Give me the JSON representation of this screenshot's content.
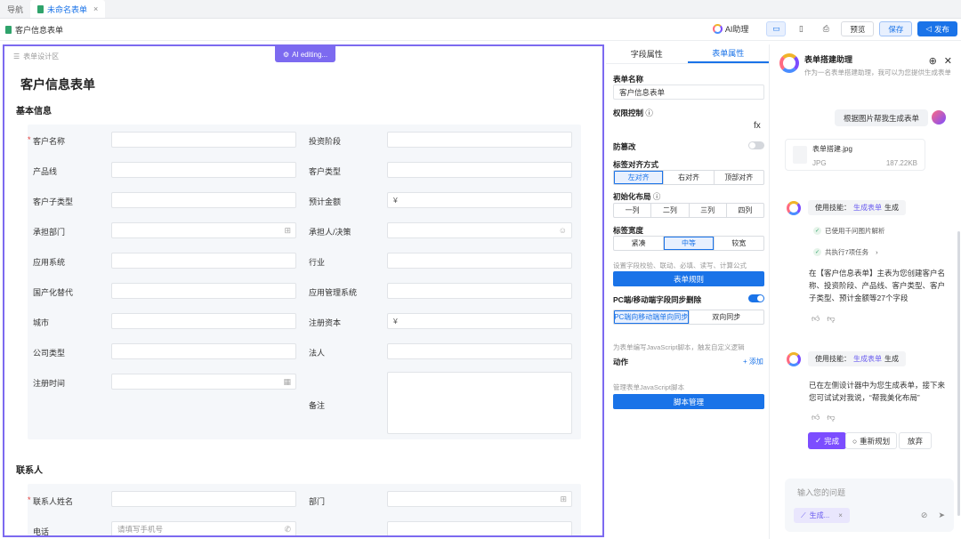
{
  "tabs": [
    {
      "label": "导航"
    },
    {
      "label": "未命名表单",
      "close": "×"
    }
  ],
  "toolbar": {
    "doc_title": "客户信息表单",
    "ai_assistant": "AI助理",
    "preview": "预览",
    "save": "保存",
    "publish": "发布"
  },
  "canvas": {
    "design_label": "表单设计区",
    "ai_editing": "AI editing...",
    "form_title": "客户信息表单",
    "section_basic": "基本信息",
    "section_contact": "联系人",
    "currency_symbol": "¥",
    "fields_basic": [
      {
        "label": "客户名称",
        "required": "*"
      },
      {
        "label": "投资阶段"
      },
      {
        "label": "产品线"
      },
      {
        "label": "客户类型"
      },
      {
        "label": "客户子类型"
      },
      {
        "label": "预计金额"
      },
      {
        "label": "承担部门"
      },
      {
        "label": "承担人/决策"
      },
      {
        "label": "应用系统"
      },
      {
        "label": "行业"
      },
      {
        "label": "国产化替代"
      },
      {
        "label": "应用管理系统"
      },
      {
        "label": "城市"
      },
      {
        "label": "注册资本"
      },
      {
        "label": "公司类型"
      },
      {
        "label": "法人"
      },
      {
        "label": "注册时间"
      },
      {
        "label": "备注"
      }
    ],
    "fields_contact": [
      {
        "label": "联系人姓名",
        "required": "*"
      },
      {
        "label": "部门"
      },
      {
        "label": "电话",
        "placeholder": "请填写手机号"
      }
    ]
  },
  "props": {
    "tab_field": "字段属性",
    "tab_form": "表单属性",
    "form_name_label": "表单名称",
    "form_name_value": "客户信息表单",
    "permission_label": "权限控制",
    "fx": "fx",
    "tamper_label": "防篡改",
    "label_align_label": "标签对齐方式",
    "label_align_opts": [
      "左对齐",
      "右对齐",
      "顶部对齐"
    ],
    "init_layout_label": "初始化布局",
    "init_layout_opts": [
      "一列",
      "二列",
      "三列",
      "四列"
    ],
    "label_width_label": "标签宽度",
    "label_width_opts": [
      "紧凑",
      "中等",
      "较宽"
    ],
    "rules_hint": "设置字段校验、联动、必填、读写、计算公式",
    "rules_btn": "表单规则",
    "sync_label": "PC端/移动端字段同步删除",
    "sync_opts": [
      "PC端向移动端单向同步",
      "双向同步"
    ],
    "js_hint": "为表单编写JavaScript脚本，触发自定义逻辑",
    "action_label": "动作",
    "add_label": "+ 添加",
    "js_manage_hint": "管理表单JavaScript脚本",
    "script_btn": "脚本管理"
  },
  "assistant": {
    "title": "表单搭建助理",
    "subtitle": "作为一名表单搭建助理，我可以为您提供生成表单",
    "user_msg": "根据图片帮我生成表单",
    "file_name": "表单搭建.jpg",
    "file_type": "JPG",
    "file_size": "187.22KB",
    "skill_prefix": "使用技能：",
    "skill_1_name": "生成表单",
    "skill_1_suffix": "生成",
    "check_1": "已使用千问图片解析",
    "check_2": "共执行7项任务",
    "resp_1": "在【客户信息表单】主表为您创建客户名称、投资阶段、产品线、客户类型、客户子类型、预计金额等27个字段",
    "skill_2_name": "生成表单",
    "skill_2_suffix": "生成",
    "resp_2": "已在左侧设计器中为您生成表单，接下来您可试试对我说，“帮我美化布局”",
    "done": "完成",
    "replan": "重新规划",
    "abandon": "放弃",
    "input_placeholder": "输入您的问题",
    "chip": "生成...",
    "chip_close": "×"
  },
  "colors": {
    "primary": "#1a73e8",
    "ai_purple": "#7c6af0",
    "required": "#e53935"
  }
}
